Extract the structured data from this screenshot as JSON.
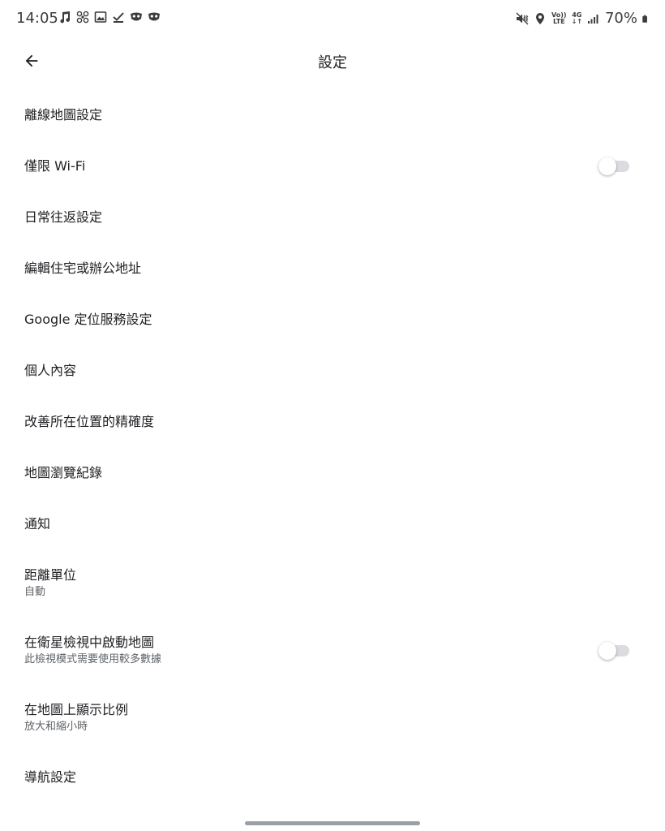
{
  "status_bar": {
    "time": "14:05",
    "left_icons": [
      "music-note-icon",
      "pinwheel-icon",
      "gallery-icon",
      "checkmark-icon",
      "mask-icon",
      "mask-icon"
    ],
    "volte_top": "Vo))",
    "volte_bottom": "LTE",
    "network_top": "4G",
    "network_bottom": "↓↑",
    "battery": "70%"
  },
  "app_bar": {
    "title": "設定",
    "back_icon": "arrow-left-icon"
  },
  "settings": [
    {
      "label": "離線地圖設定"
    },
    {
      "label": "僅限 Wi-Fi",
      "toggle": false
    },
    {
      "label": "日常往返設定"
    },
    {
      "label": "編輯住宅或辦公地址"
    },
    {
      "label": "Google 定位服務設定"
    },
    {
      "label": "個人內容"
    },
    {
      "label": "改善所在位置的精確度"
    },
    {
      "label": "地圖瀏覽紀錄"
    },
    {
      "label": "通知"
    },
    {
      "label": "距離單位",
      "sublabel": "自動"
    },
    {
      "label": "在衛星檢視中啟動地圖",
      "sublabel": "此檢視模式需要使用較多數據",
      "toggle": false
    },
    {
      "label": "在地圖上顯示比例",
      "sublabel": "放大和縮小時"
    },
    {
      "label": "導航設定"
    }
  ],
  "colors": {
    "text_primary": "#202124",
    "text_secondary": "#5f6368",
    "toggle_track_off": "#dadce0",
    "toggle_thumb_off": "#ffffff"
  }
}
